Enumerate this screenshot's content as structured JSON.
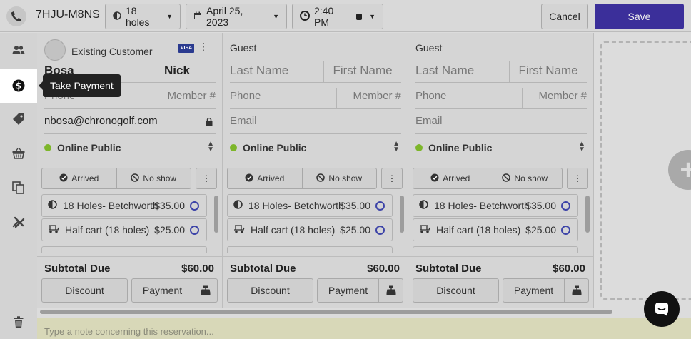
{
  "header": {
    "reservation_code": "7HJU-M8NS",
    "holes": "18 holes",
    "date": "April 25, 2023",
    "time": "2:40 PM",
    "cancel_label": "Cancel",
    "save_label": "Save"
  },
  "sidebar": {
    "tooltip": "Take Payment",
    "items": [
      "players-icon",
      "dollar-icon",
      "tag-icon",
      "basket-icon",
      "copy-icon",
      "move-icon",
      "trash-icon"
    ]
  },
  "players": [
    {
      "type": "Existing Customer",
      "last_name": "Bosa",
      "first_name": "Nick",
      "phone_placeholder": "Phone",
      "member_placeholder": "Member #",
      "email": "nbosa@chronogolf.com",
      "rate": "Online Public",
      "card": "VISA",
      "arrived": "Arrived",
      "noshow": "No show",
      "items": [
        {
          "name": "18 Holes- Betchworth",
          "price": "$35.00"
        },
        {
          "name": "Half cart (18 holes)",
          "price": "$25.00"
        }
      ],
      "subtotal_label": "Subtotal Due",
      "subtotal": "$60.00",
      "discount": "Discount",
      "payment": "Payment"
    },
    {
      "type": "Guest",
      "last_name_placeholder": "Last Name",
      "first_name_placeholder": "First Name",
      "phone_placeholder": "Phone",
      "member_placeholder": "Member #",
      "email_placeholder": "Email",
      "rate": "Online Public",
      "arrived": "Arrived",
      "noshow": "No show",
      "items": [
        {
          "name": "18 Holes- Betchworth",
          "price": "$35.00"
        },
        {
          "name": "Half cart (18 holes)",
          "price": "$25.00"
        }
      ],
      "subtotal_label": "Subtotal Due",
      "subtotal": "$60.00",
      "discount": "Discount",
      "payment": "Payment"
    },
    {
      "type": "Guest",
      "last_name_placeholder": "Last Name",
      "first_name_placeholder": "First Name",
      "phone_placeholder": "Phone",
      "member_placeholder": "Member #",
      "email_placeholder": "Email",
      "rate": "Online Public",
      "arrived": "Arrived",
      "noshow": "No show",
      "items": [
        {
          "name": "18 Holes- Betchworth",
          "price": "$35.00"
        },
        {
          "name": "Half cart (18 holes)",
          "price": "$25.00"
        }
      ],
      "subtotal_label": "Subtotal Due",
      "subtotal": "$60.00",
      "discount": "Discount",
      "payment": "Payment"
    }
  ],
  "note_placeholder": "Type a note concerning this reservation...",
  "colors": {
    "save_button": "#3b2f9a",
    "overlay_gray": "#d5d5d5",
    "rate_dot": "#7db62a",
    "item_radio": "#3d44a8",
    "note_bg": "#d8d8b8"
  }
}
